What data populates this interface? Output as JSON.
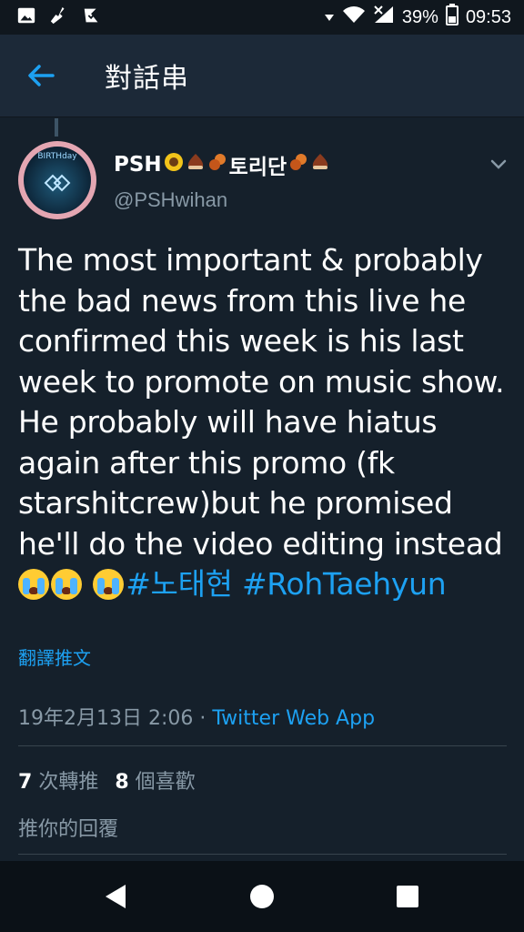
{
  "status_bar": {
    "battery": "39%",
    "time": "09:53"
  },
  "header": {
    "title": "對話串"
  },
  "tweet": {
    "display_name": "PSH",
    "display_name_mid": "토리단",
    "handle": "@PSHwihan",
    "avatar_text": "BIRTHday",
    "text_body": "The most important & probably the bad news from this live he confirmed this week is his last week to promote on music show. He probably will have hiatus again after this promo (fk starshitcrew)but he promised he'll do the video editing instead",
    "hashtags": [
      "#노태현",
      "#RohTaehyun"
    ],
    "translate_label": "翻譯推文",
    "timestamp": "19年2月13日 2:06",
    "separator": " · ",
    "source": "Twitter Web App",
    "retweets_count": "7",
    "retweets_label": "次轉推",
    "likes_count": "8",
    "likes_label": "個喜歡"
  },
  "reply": {
    "placeholder": "推你的回覆"
  },
  "colors": {
    "background": "#15202b",
    "header": "#1c2938",
    "accent": "#1da1f2",
    "muted": "#8899a6"
  }
}
